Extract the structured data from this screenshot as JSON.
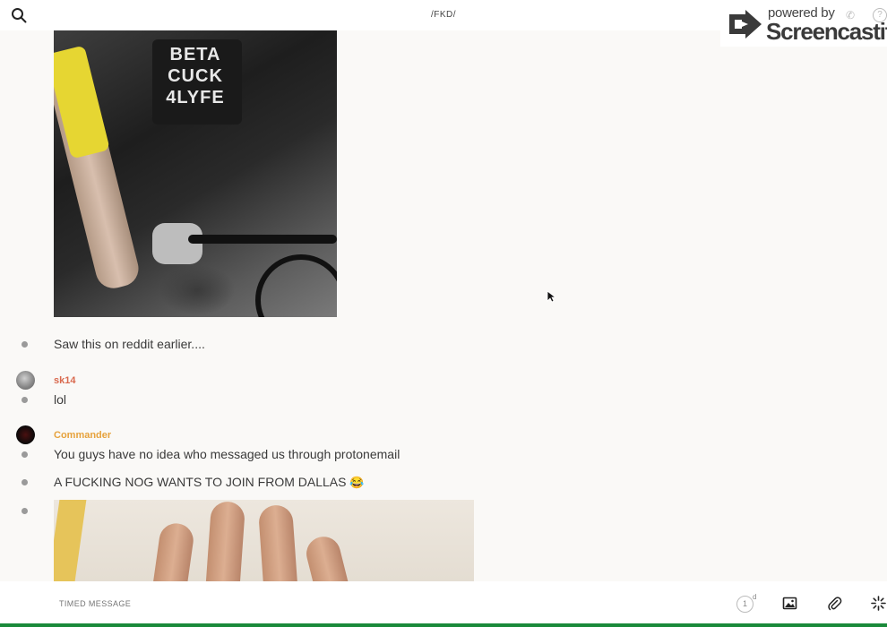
{
  "header": {
    "channel_title": "/FKD/",
    "search_icon": "search-icon"
  },
  "watermark": {
    "powered_by": "powered by",
    "brand": "Screencastify",
    "logo_icon": "screencastify-logo-icon"
  },
  "shirt_text": [
    "BETA",
    "CUCK",
    "4LYFE"
  ],
  "messages": [
    {
      "text": "Saw this on reddit earlier...."
    },
    {
      "author": "sk14",
      "text": "lol"
    },
    {
      "author": "Commander",
      "text": "You guys have no idea who messaged us through protonemail"
    },
    {
      "text": "A FUCKING NOG WANTS TO JOIN FROM DALLAS",
      "emoji": "😂"
    }
  ],
  "composer": {
    "placeholder": "TIMED MESSAGE",
    "timer_value": "1",
    "timer_unit": "d",
    "icons": [
      "timer-icon",
      "image-icon",
      "paperclip-icon",
      "sparkle-icon"
    ]
  },
  "colors": {
    "author_sk14": "#d9694e",
    "author_commander": "#e6a23c",
    "background": "#faf9f7"
  }
}
